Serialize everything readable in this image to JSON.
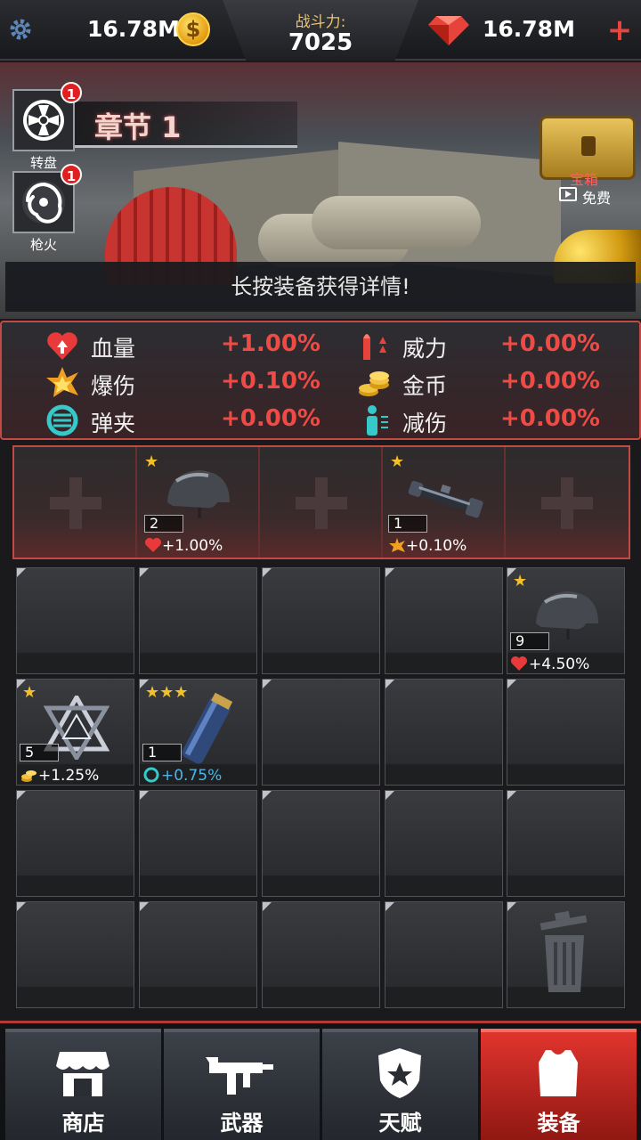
{
  "currency": {
    "coins": "16.78M",
    "gems": "16.78M",
    "coin_symbol": "$"
  },
  "power": {
    "label": "战斗力:",
    "value": "7025"
  },
  "chapter": {
    "title": "章节 1"
  },
  "side_buttons": [
    {
      "label": "转盘",
      "badge": "1"
    },
    {
      "label": "枪火",
      "badge": "1"
    }
  ],
  "chest": {
    "label": "宝箱",
    "free_label": "免费"
  },
  "hint": "长按装备获得详情!",
  "stats": [
    {
      "name": "血量",
      "value": "+1.00%",
      "icon": "heart-icon"
    },
    {
      "name": "威力",
      "value": "+0.00%",
      "icon": "bullets-icon"
    },
    {
      "name": "爆伤",
      "value": "+0.10%",
      "icon": "explosion-icon"
    },
    {
      "name": "金币",
      "value": "+0.00%",
      "icon": "coins-icon"
    },
    {
      "name": "弹夹",
      "value": "+0.00%",
      "icon": "reload-icon"
    },
    {
      "name": "减伤",
      "value": "+0.00%",
      "icon": "armor-person-icon"
    }
  ],
  "equipped": [
    {
      "empty": true
    },
    {
      "empty": false,
      "item": "helmet",
      "stars": "★",
      "level": "2",
      "bonus": "+1.00%"
    },
    {
      "empty": true
    },
    {
      "empty": false,
      "item": "scope",
      "stars": "★",
      "level": "1",
      "bonus": "+0.10%"
    },
    {
      "empty": true
    }
  ],
  "inventory": [
    {
      "item": "helmet",
      "stars": "★",
      "level": "9",
      "bonus": "+4.50%"
    },
    {
      "item": "badge",
      "stars": "★",
      "level": "5",
      "bonus": "+1.25%"
    },
    {
      "item": "magazine",
      "stars": "★★★",
      "level": "1",
      "bonus": "+0.75%"
    }
  ],
  "nav": [
    {
      "label": "商店",
      "icon": "shop-icon"
    },
    {
      "label": "武器",
      "icon": "gun-icon"
    },
    {
      "label": "天赋",
      "icon": "police-badge-icon"
    },
    {
      "label": "装备",
      "icon": "vest-icon",
      "active": true
    }
  ]
}
